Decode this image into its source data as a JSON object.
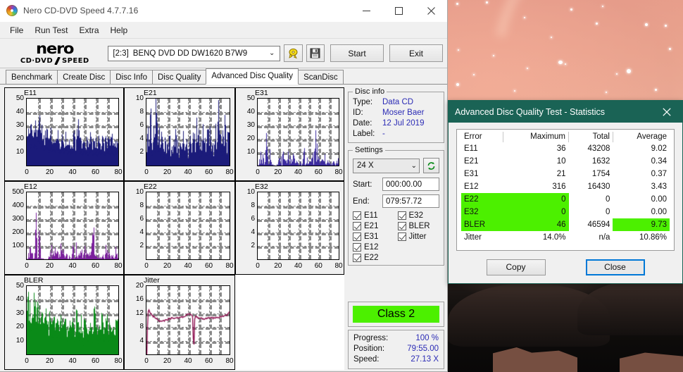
{
  "window": {
    "title": "Nero CD-DVD Speed 4.7.7.16",
    "minimize": "–",
    "maximize": "□",
    "close": "✕"
  },
  "menu": [
    "File",
    "Run Test",
    "Extra",
    "Help"
  ],
  "toolbar": {
    "logo_word": "nero",
    "logo_sub_left": "CD·DVD",
    "logo_sub_right": "SPEED",
    "drive_index": "[2:3]",
    "drive_name": "BENQ DVD DD DW1620 B7W9",
    "chevron": "⌄",
    "disc_icon": "disc-icon",
    "save_icon": "save-icon",
    "start_label": "Start",
    "exit_label": "Exit"
  },
  "tabs": [
    {
      "label": "Benchmark",
      "active": false
    },
    {
      "label": "Create Disc",
      "active": false
    },
    {
      "label": "Disc Info",
      "active": false
    },
    {
      "label": "Disc Quality",
      "active": false
    },
    {
      "label": "Advanced Disc Quality",
      "active": true
    },
    {
      "label": "ScanDisc",
      "active": false
    }
  ],
  "disc_info": {
    "legend": "Disc info",
    "rows": [
      {
        "key": "Type:",
        "value": "Data CD"
      },
      {
        "key": "ID:",
        "value": "Moser Baer"
      },
      {
        "key": "Date:",
        "value": "12 Jul 2019"
      },
      {
        "key": "Label:",
        "value": "-"
      }
    ]
  },
  "settings": {
    "legend": "Settings",
    "speed": "24 X",
    "chevron": "⌄",
    "refresh_icon": "refresh-icon",
    "start_label": "Start:",
    "start_value": "000:00.00",
    "end_label": "End:",
    "end_value": "079:57.72",
    "checkboxes": [
      {
        "label": "E11",
        "checked": true
      },
      {
        "label": "E32",
        "checked": true
      },
      {
        "label": "E21",
        "checked": true
      },
      {
        "label": "BLER",
        "checked": true
      },
      {
        "label": "E31",
        "checked": true
      },
      {
        "label": "Jitter",
        "checked": true
      },
      {
        "label": "E12",
        "checked": true
      },
      {
        "label": "",
        "checked": null
      },
      {
        "label": "E22",
        "checked": true
      },
      {
        "label": "",
        "checked": null
      }
    ]
  },
  "class_badge": {
    "label": "Class 2",
    "color": "#4cf000"
  },
  "progress": [
    {
      "key": "Progress:",
      "value": "100 %"
    },
    {
      "key": "Position:",
      "value": "79:55.00"
    },
    {
      "key": "Speed:",
      "value": "27.13 X"
    }
  ],
  "stats_dialog": {
    "title": "Advanced Disc Quality Test - Statistics",
    "close_icon": "✕",
    "columns": [
      "Error",
      "Maximum",
      "Total",
      "Average"
    ],
    "rows": [
      {
        "error": "E11",
        "maximum": "36",
        "total": "43208",
        "average": "9.02",
        "highlight": []
      },
      {
        "error": "E21",
        "maximum": "10",
        "total": "1632",
        "average": "0.34",
        "highlight": []
      },
      {
        "error": "E31",
        "maximum": "21",
        "total": "1754",
        "average": "0.37",
        "highlight": []
      },
      {
        "error": "E12",
        "maximum": "316",
        "total": "16430",
        "average": "3.43",
        "highlight": []
      },
      {
        "error": "E22",
        "maximum": "0",
        "total": "0",
        "average": "0.00",
        "highlight": [
          "error",
          "maximum"
        ]
      },
      {
        "error": "E32",
        "maximum": "0",
        "total": "0",
        "average": "0.00",
        "highlight": [
          "error",
          "maximum"
        ]
      },
      {
        "error": "BLER",
        "maximum": "46",
        "total": "46594",
        "average": "9.73",
        "highlight": [
          "error",
          "maximum",
          "average"
        ]
      },
      {
        "error": "Jitter",
        "maximum": "14.0%",
        "total": "n/a",
        "average": "10.86%",
        "highlight": []
      }
    ],
    "copy_label": "Copy",
    "close_label": "Close"
  },
  "chart_data": [
    {
      "type": "bar",
      "title": "E11",
      "color": "#1b1b7a",
      "xlabel": "",
      "ylabel": "",
      "xlim": [
        0,
        80
      ],
      "ylim": [
        0,
        50
      ],
      "xticks": [
        0,
        20,
        40,
        60,
        80
      ],
      "yticks": [
        10,
        20,
        30,
        40,
        50
      ],
      "grid": true,
      "fill": true,
      "values": [
        22,
        27,
        34,
        24,
        30,
        26,
        24,
        29,
        22,
        25,
        35,
        30,
        22,
        27,
        23,
        19,
        26,
        21,
        24,
        18,
        22,
        25,
        19,
        23,
        20,
        17,
        21,
        24,
        18,
        16,
        20,
        22,
        17,
        19,
        23,
        15,
        18,
        20,
        16,
        19,
        17,
        22,
        15,
        18,
        26,
        28,
        16,
        19,
        14,
        17,
        20,
        15,
        18,
        13,
        16,
        19,
        21,
        14,
        17,
        15,
        18,
        12,
        16,
        19,
        14,
        17,
        20,
        13,
        16,
        18,
        15,
        19,
        14,
        17,
        20,
        16,
        13,
        18,
        15,
        19
      ]
    },
    {
      "type": "bar",
      "title": "E21",
      "color": "#1b1b7a",
      "xlabel": "",
      "ylabel": "",
      "xlim": [
        0,
        80
      ],
      "ylim": [
        0,
        10
      ],
      "xticks": [
        0,
        20,
        40,
        60,
        80
      ],
      "yticks": [
        2,
        4,
        6,
        8,
        10
      ],
      "grid": true,
      "fill": true,
      "values": [
        2,
        7,
        4,
        5,
        8,
        2,
        4,
        6,
        3,
        10,
        7,
        3,
        5,
        2,
        4,
        6,
        2,
        3,
        5,
        1,
        4,
        2,
        6,
        1,
        4,
        2,
        5,
        3,
        6,
        2,
        4,
        1,
        5,
        3,
        2,
        6,
        4,
        2,
        5,
        3,
        1,
        4,
        6,
        2,
        5,
        3,
        4,
        2,
        6,
        3,
        5,
        1,
        4,
        2,
        6,
        3,
        5,
        2,
        4,
        6,
        3,
        5,
        2,
        4,
        1,
        3,
        6,
        2,
        5,
        8,
        4,
        6,
        2,
        5,
        3,
        6,
        4,
        2,
        5,
        4
      ]
    },
    {
      "type": "bar",
      "title": "E31",
      "color": "#3b2a9e",
      "xlabel": "",
      "ylabel": "",
      "xlim": [
        0,
        80
      ],
      "ylim": [
        0,
        50
      ],
      "xticks": [
        0,
        20,
        40,
        60,
        80
      ],
      "yticks": [
        10,
        20,
        30,
        40,
        50
      ],
      "grid": true,
      "fill": false,
      "values": [
        1,
        3,
        5,
        17,
        2,
        6,
        4,
        9,
        20,
        12,
        5,
        17,
        8,
        3,
        6,
        2,
        1,
        0,
        0,
        1,
        3,
        5,
        2,
        7,
        4,
        11,
        3,
        6,
        2,
        5,
        8,
        3,
        6,
        2,
        5,
        9,
        4,
        2,
        6,
        3,
        7,
        5,
        2,
        8,
        4,
        6,
        10,
        3,
        5,
        2,
        7,
        4,
        9,
        3,
        6,
        2,
        12,
        18,
        16,
        10,
        6,
        4,
        2,
        8,
        5,
        3,
        7,
        2,
        5,
        9,
        4,
        3,
        6,
        2,
        8,
        5,
        3,
        6,
        2,
        4
      ]
    },
    {
      "type": "bar",
      "title": "E12",
      "color": "#7a1f9c",
      "xlabel": "",
      "ylabel": "",
      "xlim": [
        0,
        80
      ],
      "ylim": [
        0,
        500
      ],
      "xticks": [
        0,
        20,
        40,
        60,
        80
      ],
      "yticks": [
        100,
        200,
        300,
        400,
        500
      ],
      "grid": true,
      "fill": false,
      "values": [
        10,
        30,
        60,
        200,
        25,
        40,
        15,
        80,
        305,
        70,
        140,
        225,
        50,
        30,
        20,
        10,
        5,
        0,
        0,
        15,
        35,
        110,
        20,
        60,
        40,
        95,
        30,
        70,
        25,
        50,
        100,
        35,
        60,
        20,
        45,
        95,
        40,
        25,
        60,
        30,
        70,
        50,
        25,
        80,
        40,
        60,
        95,
        30,
        50,
        20,
        70,
        40,
        90,
        30,
        60,
        25,
        120,
        225,
        195,
        100,
        60,
        40,
        20,
        80,
        50,
        30,
        70,
        20,
        130,
        90,
        40,
        30,
        60,
        20,
        80,
        50,
        30,
        60,
        20,
        40
      ]
    },
    {
      "type": "bar",
      "title": "E22",
      "color": "#1b1b7a",
      "xlabel": "",
      "ylabel": "",
      "xlim": [
        0,
        80
      ],
      "ylim": [
        0,
        10
      ],
      "xticks": [
        0,
        20,
        40,
        60,
        80
      ],
      "yticks": [
        2,
        4,
        6,
        8,
        10
      ],
      "grid": true,
      "fill": false,
      "values": []
    },
    {
      "type": "bar",
      "title": "E32",
      "color": "#1b1b7a",
      "xlabel": "",
      "ylabel": "",
      "xlim": [
        0,
        80
      ],
      "ylim": [
        0,
        10
      ],
      "xticks": [
        0,
        20,
        40,
        60,
        80
      ],
      "yticks": [
        2,
        4,
        6,
        8,
        10
      ],
      "grid": true,
      "fill": false,
      "values": []
    },
    {
      "type": "bar",
      "title": "BLER",
      "color": "#0a8a18",
      "xlabel": "",
      "ylabel": "",
      "xlim": [
        0,
        80
      ],
      "ylim": [
        0,
        50
      ],
      "xticks": [
        0,
        20,
        40,
        60,
        80
      ],
      "yticks": [
        10,
        20,
        30,
        40,
        50
      ],
      "grid": true,
      "fill": true,
      "values": [
        31,
        46,
        28,
        33,
        30,
        25,
        41,
        38,
        27,
        41,
        30,
        28,
        33,
        25,
        30,
        22,
        26,
        31,
        24,
        19,
        28,
        22,
        25,
        20,
        27,
        22,
        18,
        30,
        21,
        24,
        20,
        26,
        18,
        22,
        25,
        17,
        20,
        28,
        19,
        22,
        24,
        16,
        19,
        30,
        26,
        20,
        18,
        23,
        21,
        12,
        25,
        18,
        21,
        16,
        24,
        19,
        22,
        15,
        30,
        33,
        25,
        20,
        14,
        24,
        18,
        29,
        21,
        16,
        23,
        19,
        25,
        17,
        21,
        26,
        18,
        23,
        16,
        21,
        19,
        22
      ]
    },
    {
      "type": "line",
      "title": "Jitter",
      "color": "#8e1050",
      "xlabel": "",
      "ylabel": "",
      "xlim": [
        0,
        80
      ],
      "ylim": [
        0,
        20
      ],
      "xticks": [
        0,
        20,
        40,
        60,
        80
      ],
      "yticks": [
        4,
        8,
        12,
        16,
        20
      ],
      "grid": true,
      "fill": false,
      "values": [
        0,
        12.6,
        13.1,
        12.3,
        11.8,
        11.4,
        11.2,
        11.0,
        10.8,
        10.6,
        10.2,
        9.9,
        9.7,
        9.6,
        9.5,
        9.6,
        9.8,
        9.9,
        10.0,
        10.1,
        10.2,
        10.3,
        10.4,
        10.5,
        10.6,
        10.5,
        10.6,
        10.7,
        10.6,
        10.7,
        10.8,
        10.7,
        10.8,
        10.9,
        11.0,
        10.9,
        11.1,
        11.3,
        11.6,
        11.9,
        12.1,
        11.9,
        11.6,
        11.4,
        11.2,
        0,
        11.3,
        11.1,
        10.9,
        10.8,
        10.7,
        10.6,
        10.5,
        10.6,
        10.5,
        10.4,
        10.5,
        10.6,
        10.5,
        10.6,
        10.5,
        10.6,
        10.7,
        10.6,
        10.7,
        10.8,
        10.7,
        10.8,
        10.9,
        10.8,
        10.9,
        11.0,
        11.1,
        11.0,
        11.2,
        11.3,
        11.4,
        11.6,
        11.9,
        12.4
      ]
    }
  ]
}
